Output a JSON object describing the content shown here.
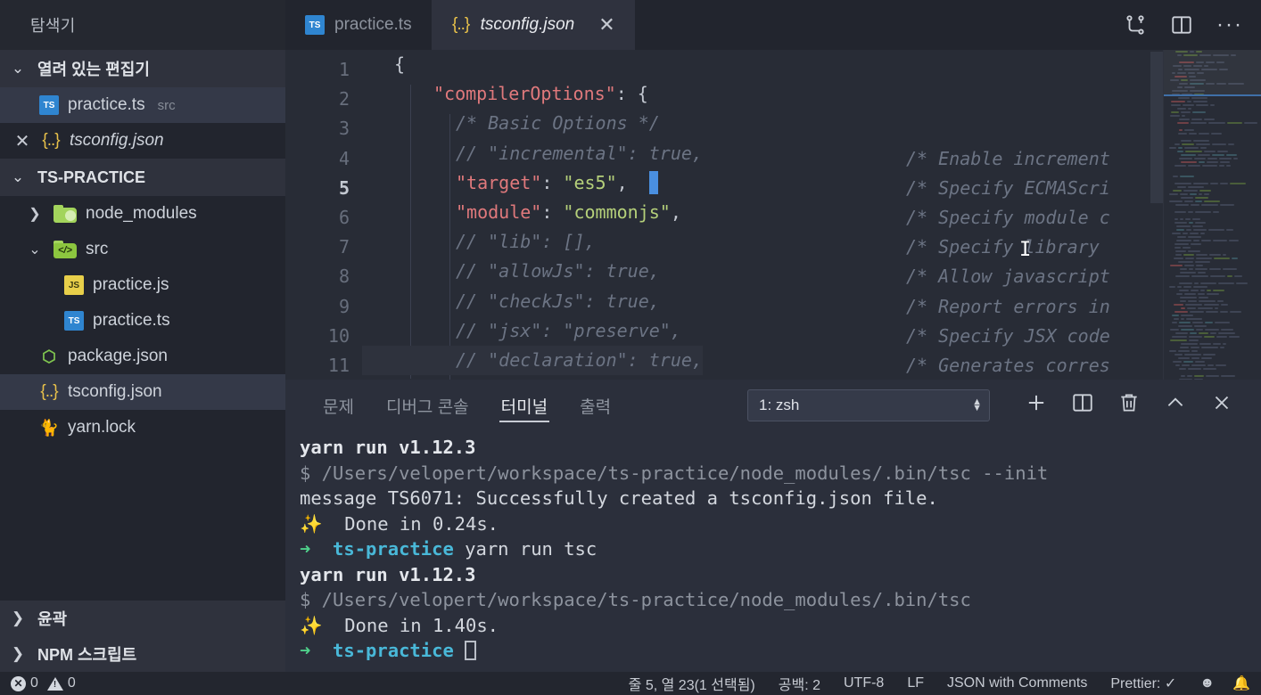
{
  "sidebar": {
    "title": "탐색기",
    "open_editors": {
      "label": "열려 있는 편집기",
      "items": [
        {
          "name": "practice.ts",
          "suffix": "src",
          "icon": "typescript-file-icon",
          "selected": true,
          "closable": false
        },
        {
          "name": "tsconfig.json",
          "suffix": "",
          "icon": "json-file-icon",
          "selected": false,
          "closable": true
        }
      ]
    },
    "project": {
      "label": "TS-PRACTICE",
      "items": [
        {
          "name": "node_modules",
          "type": "folder",
          "icon": "folder-icon",
          "expanded": false,
          "depth": 1
        },
        {
          "name": "src",
          "type": "folder",
          "icon": "folder-src-icon",
          "expanded": true,
          "depth": 1
        },
        {
          "name": "practice.js",
          "type": "file",
          "icon": "javascript-file-icon",
          "depth": 2
        },
        {
          "name": "practice.ts",
          "type": "file",
          "icon": "typescript-file-icon",
          "depth": 2
        },
        {
          "name": "package.json",
          "type": "file",
          "icon": "nodejs-file-icon",
          "depth": 1
        },
        {
          "name": "tsconfig.json",
          "type": "file",
          "icon": "json-file-icon",
          "depth": 1,
          "selected": true
        },
        {
          "name": "yarn.lock",
          "type": "file",
          "icon": "yarn-file-icon",
          "depth": 1
        }
      ]
    },
    "bottom_sections": [
      {
        "label": "윤곽",
        "expanded": false
      },
      {
        "label": "NPM 스크립트",
        "expanded": false
      }
    ]
  },
  "tabs": [
    {
      "label": "practice.ts",
      "icon": "typescript-file-icon",
      "active": false,
      "closable": false
    },
    {
      "label": "tsconfig.json",
      "icon": "json-file-icon",
      "active": true,
      "closable": true,
      "close_glyph": "✕"
    }
  ],
  "title_actions": [
    {
      "name": "split-in-group-icon",
      "glyph": "⑂"
    },
    {
      "name": "split-editor-icon",
      "glyph": "▣"
    },
    {
      "name": "more-actions-icon",
      "glyph": "···"
    }
  ],
  "editor": {
    "language": "JSON with Comments",
    "lines": [
      {
        "num": "1",
        "indent": 0,
        "segments": [
          {
            "t": "{",
            "k": "punc"
          }
        ],
        "comment": ""
      },
      {
        "num": "2",
        "indent": 1,
        "segments": [
          {
            "t": "\"compilerOptions\"",
            "k": "key"
          },
          {
            "t": ": {",
            "k": "punc"
          }
        ],
        "comment": ""
      },
      {
        "num": "3",
        "indent": 2,
        "segments": [
          {
            "t": "/* Basic Options */",
            "k": "cmt"
          }
        ],
        "comment": ""
      },
      {
        "num": "4",
        "indent": 2,
        "segments": [
          {
            "t": "// \"incremental\": true,",
            "k": "cmt"
          }
        ],
        "comment": "/* Enable increment"
      },
      {
        "num": "5",
        "indent": 2,
        "segments": [
          {
            "t": "\"target\"",
            "k": "key"
          },
          {
            "t": ": ",
            "k": "punc"
          },
          {
            "t": "\"es5\"",
            "k": "str"
          },
          {
            "t": ",",
            "k": "punc"
          }
        ],
        "comment": "/* Specify ECMAScri",
        "current": true
      },
      {
        "num": "6",
        "indent": 2,
        "segments": [
          {
            "t": "\"module\"",
            "k": "key"
          },
          {
            "t": ": ",
            "k": "punc"
          },
          {
            "t": "\"commonjs\"",
            "k": "str"
          },
          {
            "t": ",",
            "k": "punc"
          }
        ],
        "comment": "/* Specify module c"
      },
      {
        "num": "7",
        "indent": 2,
        "segments": [
          {
            "t": "// \"lib\": [],",
            "k": "cmt"
          }
        ],
        "comment": "/* Specify library"
      },
      {
        "num": "8",
        "indent": 2,
        "segments": [
          {
            "t": "// \"allowJs\": true,",
            "k": "cmt"
          }
        ],
        "comment": "/* Allow javascript"
      },
      {
        "num": "9",
        "indent": 2,
        "segments": [
          {
            "t": "// \"checkJs\": true,",
            "k": "cmt"
          }
        ],
        "comment": "/* Report errors in"
      },
      {
        "num": "10",
        "indent": 2,
        "segments": [
          {
            "t": "// \"jsx\": \"preserve\",",
            "k": "cmt"
          }
        ],
        "comment": "/* Specify JSX code"
      },
      {
        "num": "11",
        "indent": 2,
        "segments": [
          {
            "t": "// \"declaration\": true,",
            "k": "cmt"
          }
        ],
        "comment": "/* Generates corres",
        "highlighted": true
      }
    ]
  },
  "panel": {
    "tabs": [
      {
        "label": "문제",
        "active": false
      },
      {
        "label": "디버그 콘솔",
        "active": false
      },
      {
        "label": "터미널",
        "active": true
      },
      {
        "label": "출력",
        "active": false
      }
    ],
    "terminal_select": "1: zsh",
    "actions": [
      {
        "name": "new-terminal-icon",
        "glyph": "＋"
      },
      {
        "name": "split-terminal-icon",
        "glyph": "▣"
      },
      {
        "name": "kill-terminal-icon",
        "glyph": "🗑"
      },
      {
        "name": "maximize-panel-icon",
        "glyph": "︿"
      },
      {
        "name": "close-panel-icon",
        "glyph": "✕"
      }
    ],
    "terminal_lines": [
      {
        "parts": [
          {
            "t": "yarn run v1.12.3",
            "k": "bold"
          }
        ]
      },
      {
        "parts": [
          {
            "t": "$ /Users/velopert/workspace/ts-practice/node_modules/.bin/tsc --init",
            "k": "dim"
          }
        ]
      },
      {
        "parts": [
          {
            "t": "message TS6071: Successfully created a tsconfig.json file.",
            "k": "plain"
          }
        ]
      },
      {
        "parts": [
          {
            "t": "✨",
            "k": "yellow"
          },
          {
            "t": "  Done in 0.24s.",
            "k": "plain"
          }
        ]
      },
      {
        "parts": [
          {
            "t": "➜",
            "k": "green"
          },
          {
            "t": "  ",
            "k": "plain"
          },
          {
            "t": "ts-practice",
            "k": "cyan"
          },
          {
            "t": " yarn run tsc",
            "k": "plain"
          }
        ]
      },
      {
        "parts": [
          {
            "t": "yarn run v1.12.3",
            "k": "bold"
          }
        ]
      },
      {
        "parts": [
          {
            "t": "$ /Users/velopert/workspace/ts-practice/node_modules/.bin/tsc",
            "k": "dim"
          }
        ]
      },
      {
        "parts": [
          {
            "t": "✨",
            "k": "yellow"
          },
          {
            "t": "  Done in 1.40s.",
            "k": "plain"
          }
        ]
      },
      {
        "parts": [
          {
            "t": "➜",
            "k": "green"
          },
          {
            "t": "  ",
            "k": "plain"
          },
          {
            "t": "ts-practice",
            "k": "cyan"
          },
          {
            "t": " ",
            "k": "plain"
          },
          {
            "t": "█",
            "k": "cursor"
          }
        ]
      }
    ]
  },
  "statusbar": {
    "errors": "0",
    "warnings": "0",
    "cursor_position": "줄 5, 열 23(1 선택됨)",
    "indentation": "공백: 2",
    "encoding": "UTF-8",
    "eol": "LF",
    "language": "JSON with Comments",
    "prettier": "Prettier: ✓",
    "feedback_icon": "smiley-icon",
    "bell_icon": "bell-icon"
  },
  "colors": {
    "accent": "#4a8fe0",
    "terminal_green": "#4fd18b",
    "terminal_cyan": "#49b8d8",
    "string": "#b5d07a",
    "key": "#e0797c"
  }
}
